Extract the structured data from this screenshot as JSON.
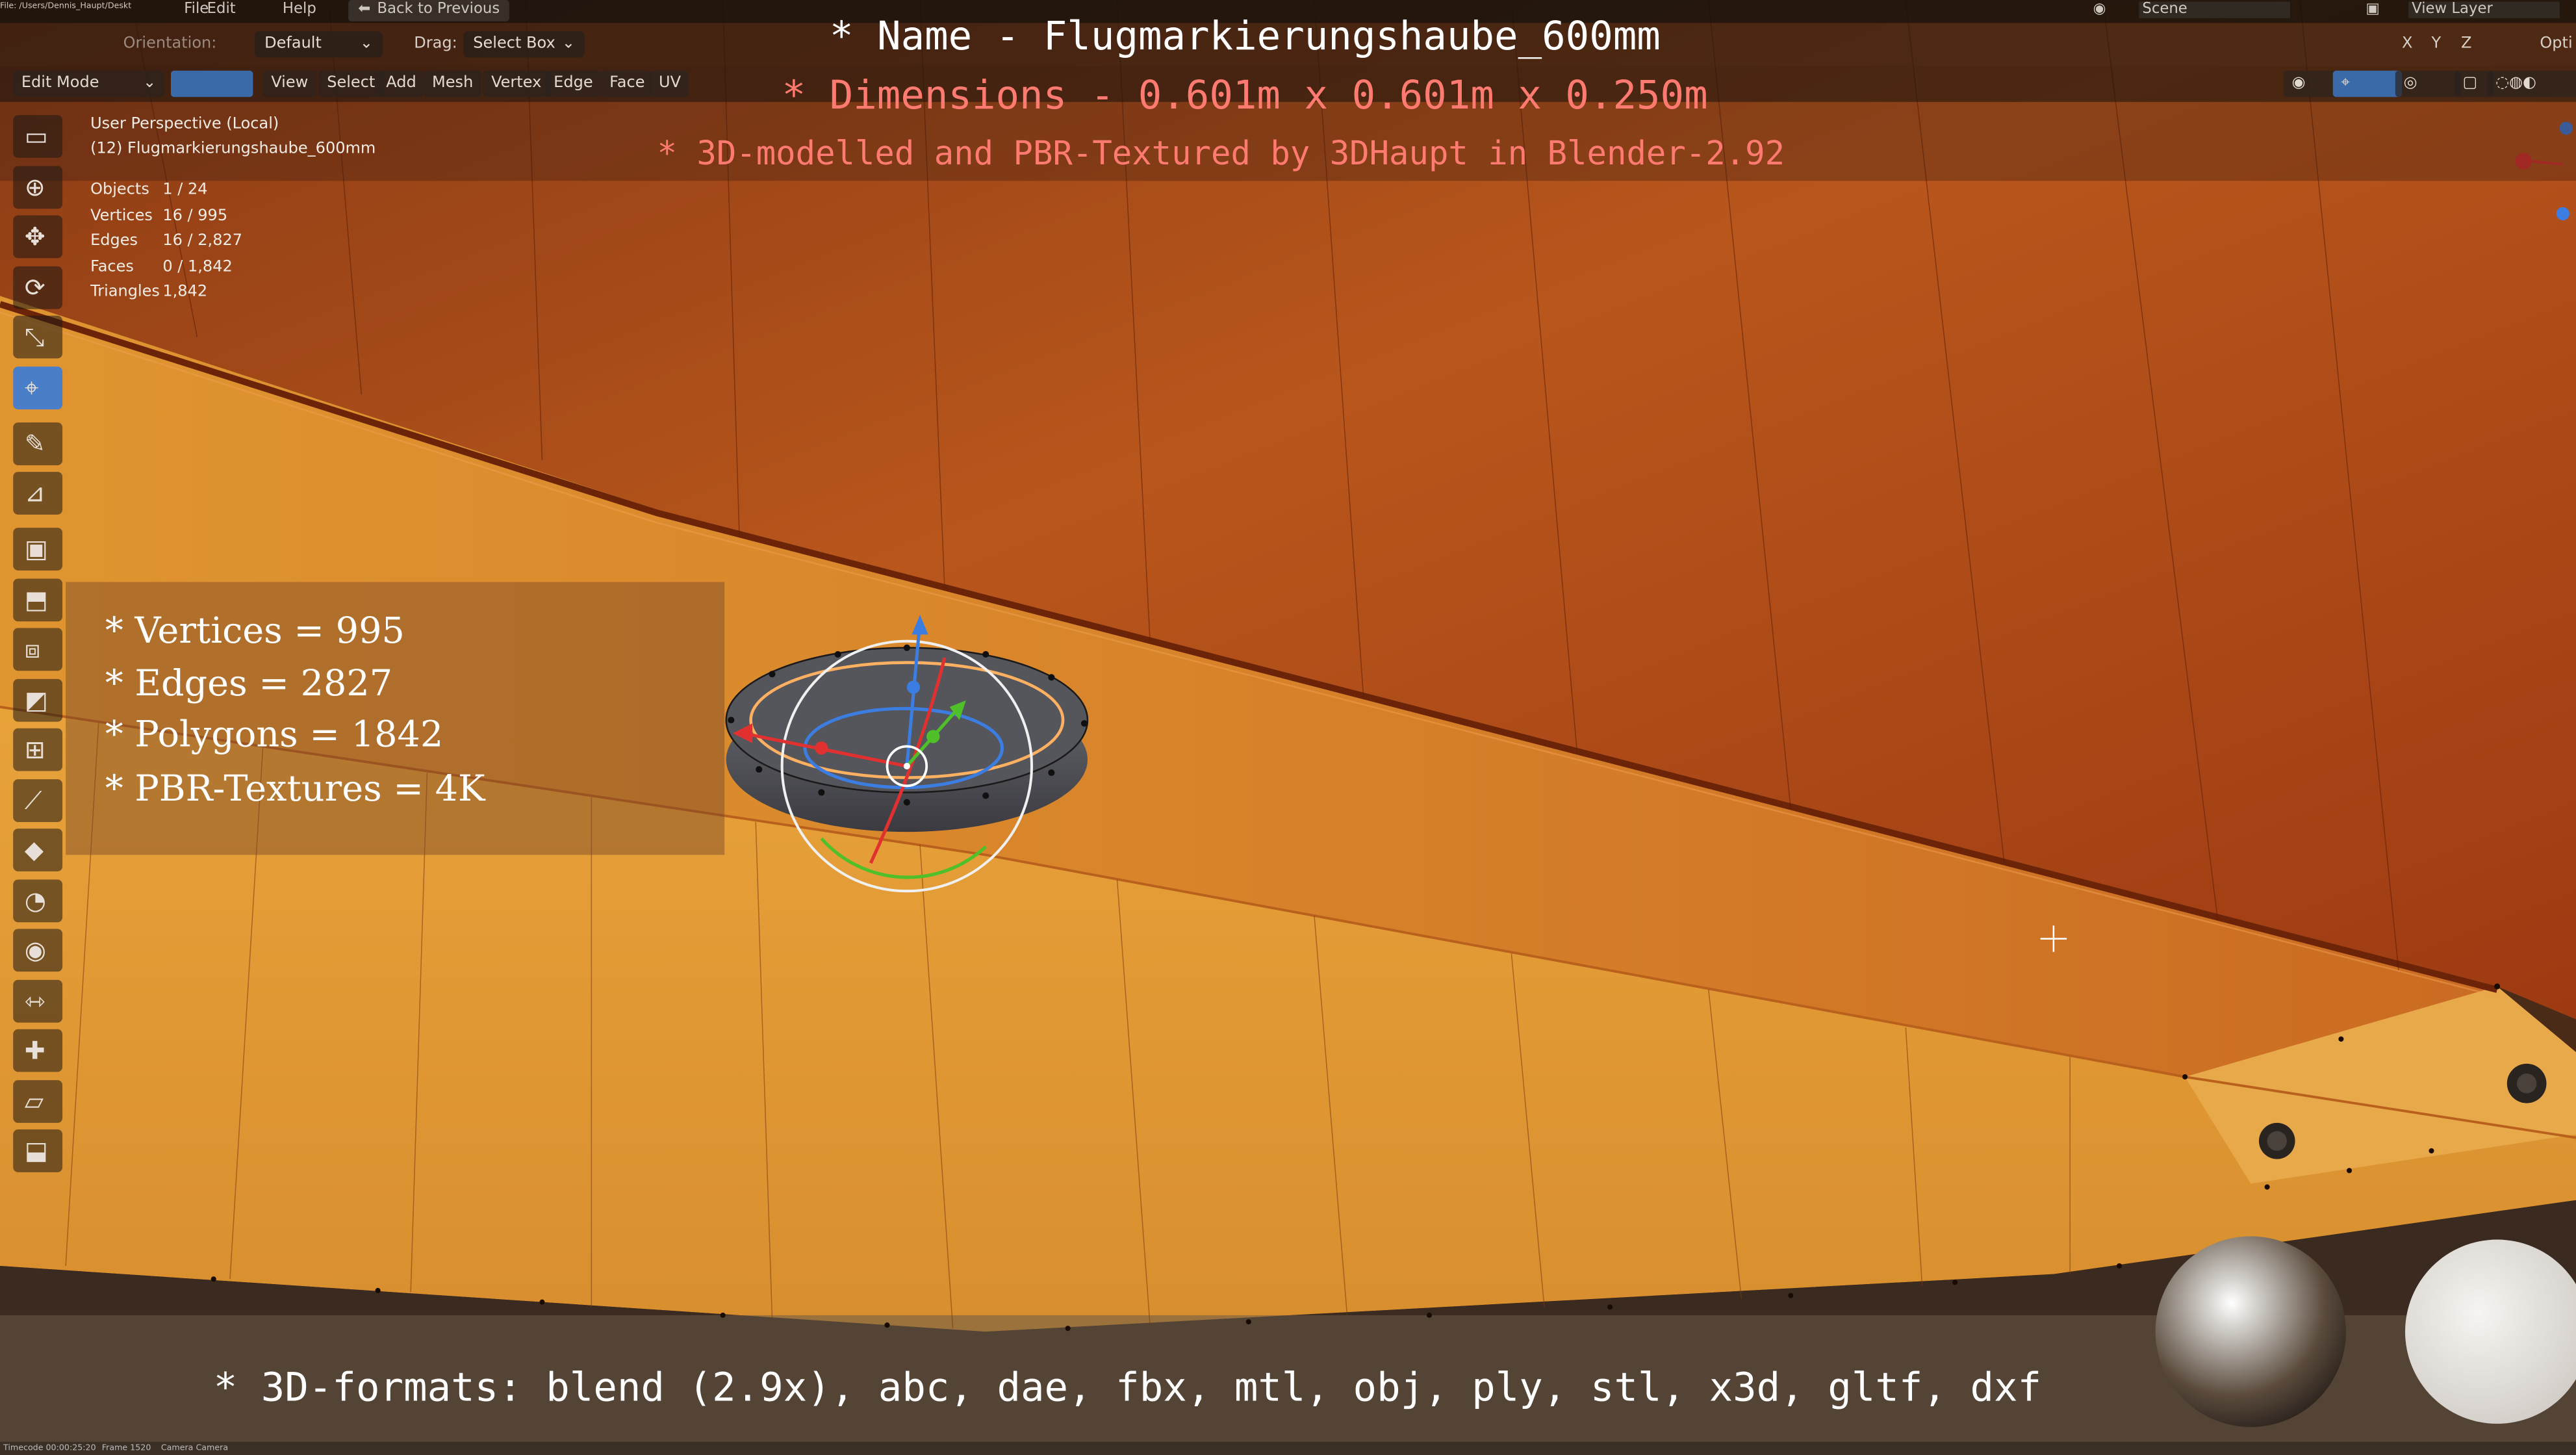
{
  "menubar": {
    "file_path": "File: /Users/Dennis_Haupt/Desktop/Screen Shot... .blend",
    "menu_file": "File",
    "menu_edit": "Edit",
    "menu_help": "Help",
    "back_button": "Back to Previous",
    "scene_label": "Scene",
    "view_layer_label": "View Layer"
  },
  "toolsettings": {
    "orientation_label": "Orientation:",
    "orientation_value": "Default",
    "drag_label": "Drag:",
    "drag_value": "Select Box"
  },
  "header": {
    "mode": "Edit Mode",
    "menus": [
      "View",
      "Select",
      "Add",
      "Mesh",
      "Vertex",
      "Edge",
      "Face",
      "UV"
    ],
    "axes": [
      "X",
      "Y",
      "Z"
    ],
    "options": "Opti"
  },
  "viewport_info": {
    "perspective": "User Perspective (Local)",
    "object": "(12) Flugmarkierungshaube_600mm",
    "stats": [
      {
        "label": "Objects",
        "value": "1 / 24"
      },
      {
        "label": "Vertices",
        "value": "16 / 995"
      },
      {
        "label": "Edges",
        "value": "16 / 2,827"
      },
      {
        "label": "Faces",
        "value": "0 / 1,842"
      },
      {
        "label": "Triangles",
        "value": "1,842"
      }
    ]
  },
  "overlay": {
    "name_line": "* Name - Flugmarkierungshaube_600mm",
    "dims_line": "* Dimensions -  0.601m x 0.601m x 0.250m",
    "credit_line": "* 3D-modelled and PBR-Textured by 3DHaupt in Blender-2.92",
    "info_lines": [
      "* Vertices = 995",
      "* Edges = 2827",
      "* Polygons = 1842",
      "* PBR-Textures = 4K"
    ],
    "formats_line": "* 3D-formats: blend (2.9x), abc, dae, fbx, mtl, obj, ply, stl, x3d, gltf, dxf"
  },
  "statusbar": {
    "timecode": "Timecode 00:00:25:20",
    "frame": "Frame 1520",
    "camera": "Camera Camera"
  },
  "tools": [
    "select-box",
    "cursor",
    "move",
    "rotate",
    "scale",
    "transform",
    "annotate",
    "measure",
    "add-cube",
    "extrude",
    "inset",
    "bevel",
    "loop-cut",
    "knife",
    "poly-build",
    "spin",
    "smooth",
    "edge-slide",
    "shrink-fatten",
    "shear",
    "rip"
  ],
  "colors": {
    "accent_active": "#4a7ec8",
    "overlay_red": "#ff7a70",
    "surface_orange": "#d9841f"
  }
}
